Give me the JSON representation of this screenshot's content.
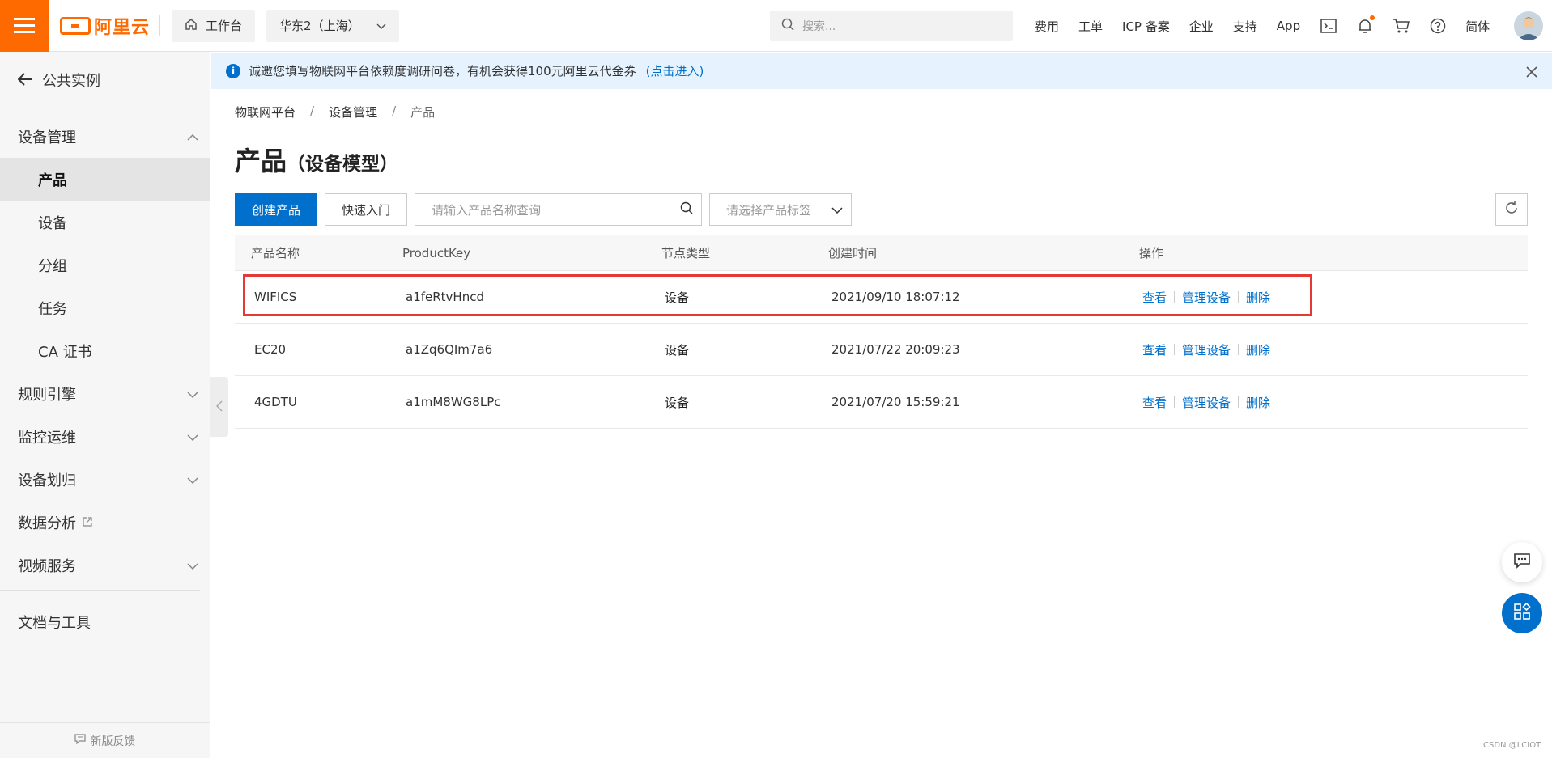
{
  "header": {
    "logo_text": "阿里云",
    "workbench_label": "工作台",
    "region_label": "华东2（上海）",
    "search_placeholder": "搜索...",
    "links": [
      "费用",
      "工单",
      "ICP 备案",
      "企业",
      "支持",
      "App"
    ],
    "lang_label": "简体"
  },
  "notice": {
    "text": "诚邀您填写物联网平台依赖度调研问卷，有机会获得100元阿里云代金券",
    "link_text": "(点击进入)"
  },
  "sidebar": {
    "back_label": "公共实例",
    "groups": {
      "device_mgmt": "设备管理",
      "rules": "规则引擎",
      "monitor": "监控运维",
      "device_assign": "设备划归",
      "data_analysis": "数据分析",
      "video": "视频服务",
      "docs": "文档与工具"
    },
    "sub_items": [
      "产品",
      "设备",
      "分组",
      "任务",
      "CA 证书"
    ],
    "feedback_label": "新版反馈"
  },
  "breadcrumb": [
    "物联网平台",
    "设备管理",
    "产品"
  ],
  "page": {
    "title": "产品",
    "subtitle": "（设备模型）"
  },
  "toolbar": {
    "create_label": "创建产品",
    "quickstart_label": "快速入门",
    "search_placeholder": "请输入产品名称查询",
    "tag_placeholder": "请选择产品标签"
  },
  "table": {
    "columns": [
      "产品名称",
      "ProductKey",
      "节点类型",
      "创建时间",
      "操作"
    ],
    "rows": [
      {
        "name": "WIFICS",
        "key": "a1feRtvHncd",
        "node": "设备",
        "created": "2021/09/10 18:07:12"
      },
      {
        "name": "EC20",
        "key": "a1Zq6QIm7a6",
        "node": "设备",
        "created": "2021/07/22 20:09:23"
      },
      {
        "name": "4GDTU",
        "key": "a1mM8WG8LPc",
        "node": "设备",
        "created": "2021/07/20 15:59:21"
      }
    ],
    "actions": [
      "查看",
      "管理设备",
      "删除"
    ]
  },
  "watermark": "CSDN @LCIOT",
  "colors": {
    "brand": "#ff6a00",
    "primary": "#0070cc",
    "highlight": "#e53935"
  }
}
